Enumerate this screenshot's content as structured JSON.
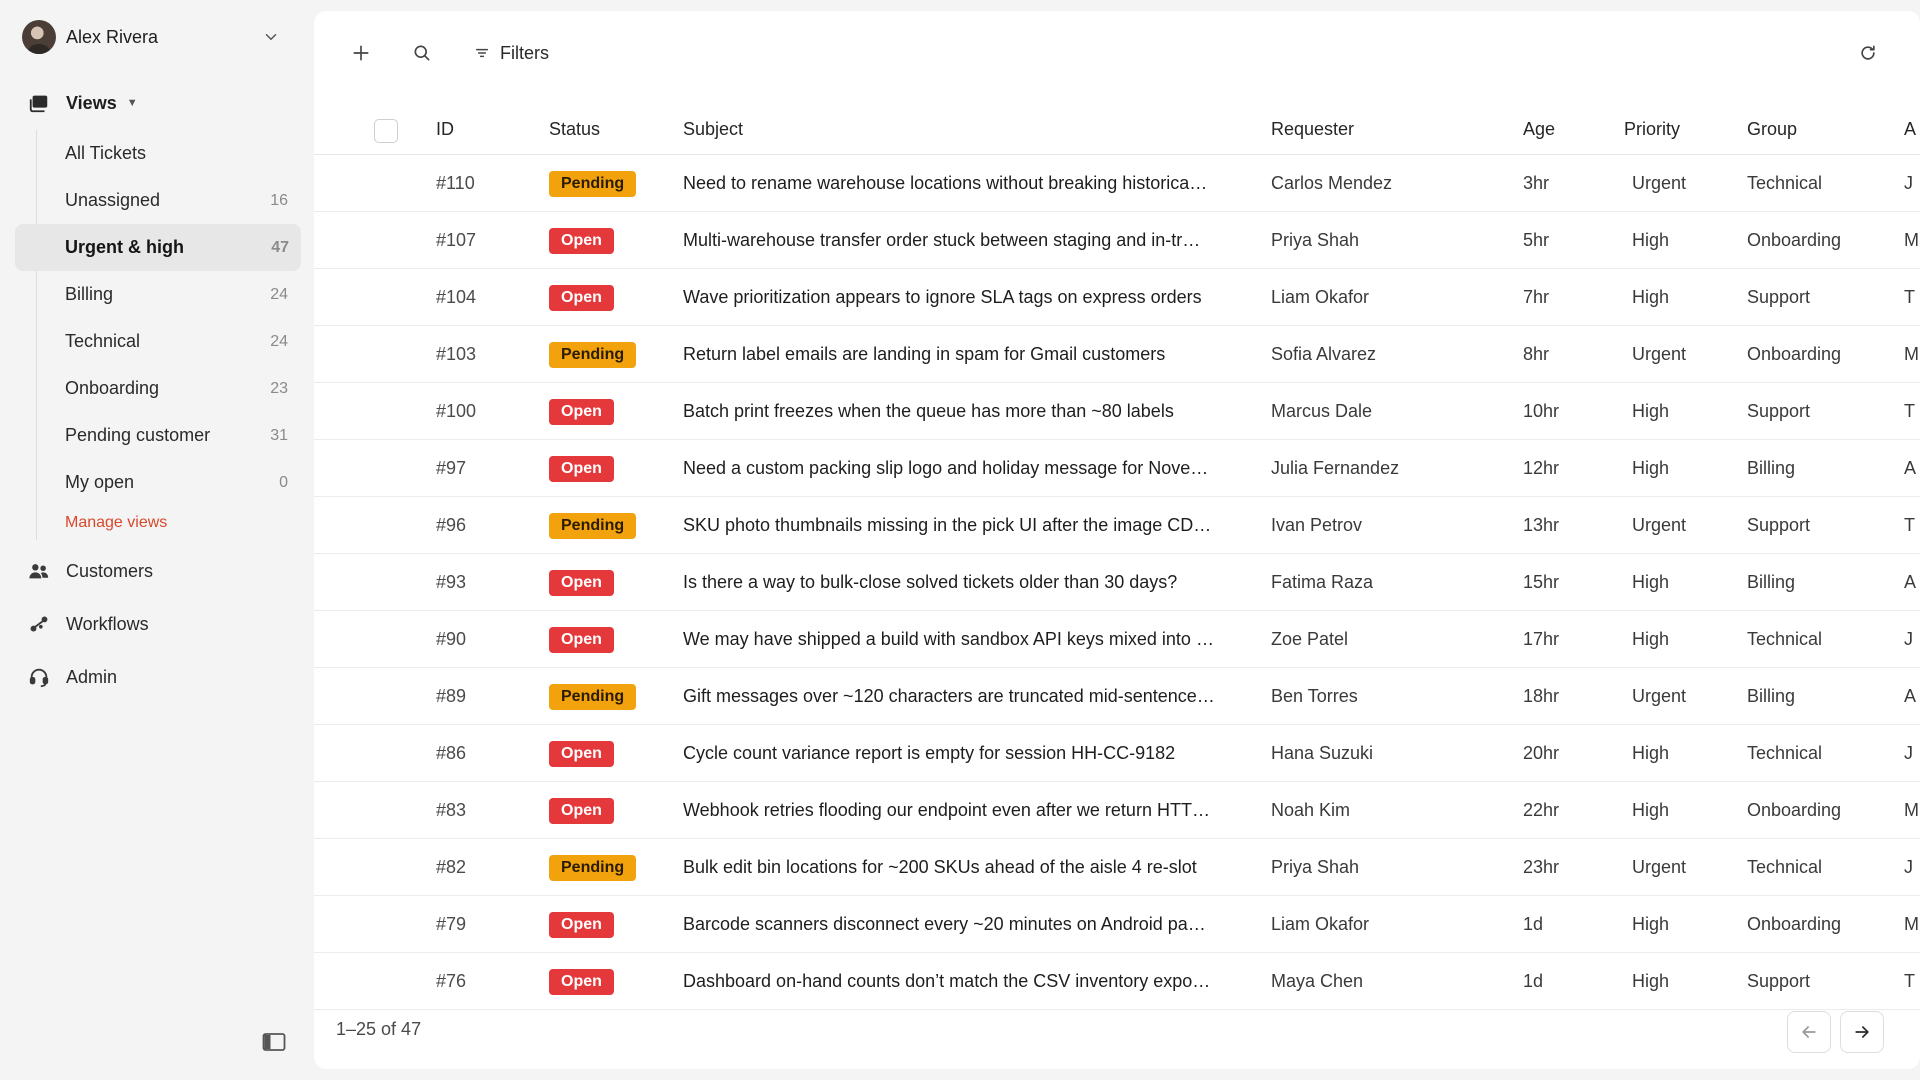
{
  "user": {
    "name": "Alex Rivera"
  },
  "sidebar": {
    "views_label": "Views",
    "views": [
      {
        "label": "All Tickets",
        "count": ""
      },
      {
        "label": "Unassigned",
        "count": "16"
      },
      {
        "label": "Urgent & high",
        "count": "47",
        "active": true
      },
      {
        "label": "Billing",
        "count": "24"
      },
      {
        "label": "Technical",
        "count": "24"
      },
      {
        "label": "Onboarding",
        "count": "23"
      },
      {
        "label": "Pending customer",
        "count": "31"
      },
      {
        "label": "My open",
        "count": "0"
      }
    ],
    "manage_views": "Manage views",
    "nav": [
      {
        "label": "Customers",
        "icon": "users-icon"
      },
      {
        "label": "Workflows",
        "icon": "workflow-icon"
      },
      {
        "label": "Admin",
        "icon": "headset-icon"
      }
    ]
  },
  "toolbar": {
    "filters_label": "Filters"
  },
  "table": {
    "columns": {
      "id": "ID",
      "status": "Status",
      "subject": "Subject",
      "requester": "Requester",
      "age": "Age",
      "priority": "Priority",
      "group": "Group"
    },
    "rows": [
      {
        "id": "#110",
        "status": "Pending",
        "subject": "Need to rename warehouse locations without breaking historica…",
        "requester": "Carlos Mendez",
        "age": "3hr",
        "priority": "Urgent",
        "group": "Technical",
        "extra": "J"
      },
      {
        "id": "#107",
        "status": "Open",
        "subject": "Multi-warehouse transfer order stuck between staging and in-tr…",
        "requester": "Priya Shah",
        "age": "5hr",
        "priority": "High",
        "group": "Onboarding",
        "extra": "M"
      },
      {
        "id": "#104",
        "status": "Open",
        "subject": "Wave prioritization appears to ignore SLA tags on express orders",
        "requester": "Liam Okafor",
        "age": "7hr",
        "priority": "High",
        "group": "Support",
        "extra": "T"
      },
      {
        "id": "#103",
        "status": "Pending",
        "subject": "Return label emails are landing in spam for Gmail customers",
        "requester": "Sofia Alvarez",
        "age": "8hr",
        "priority": "Urgent",
        "group": "Onboarding",
        "extra": "M"
      },
      {
        "id": "#100",
        "status": "Open",
        "subject": "Batch print freezes when the queue has more than ~80 labels",
        "requester": "Marcus Dale",
        "age": "10hr",
        "priority": "High",
        "group": "Support",
        "extra": "T"
      },
      {
        "id": "#97",
        "status": "Open",
        "subject": "Need a custom packing slip logo and holiday message for Nove…",
        "requester": "Julia Fernandez",
        "age": "12hr",
        "priority": "High",
        "group": "Billing",
        "extra": "A"
      },
      {
        "id": "#96",
        "status": "Pending",
        "subject": "SKU photo thumbnails missing in the pick UI after the image CD…",
        "requester": "Ivan Petrov",
        "age": "13hr",
        "priority": "Urgent",
        "group": "Support",
        "extra": "T"
      },
      {
        "id": "#93",
        "status": "Open",
        "subject": "Is there a way to bulk-close solved tickets older than 30 days?",
        "requester": "Fatima Raza",
        "age": "15hr",
        "priority": "High",
        "group": "Billing",
        "extra": "A"
      },
      {
        "id": "#90",
        "status": "Open",
        "subject": "We may have shipped a build with sandbox API keys mixed into …",
        "requester": "Zoe Patel",
        "age": "17hr",
        "priority": "High",
        "group": "Technical",
        "extra": "J"
      },
      {
        "id": "#89",
        "status": "Pending",
        "subject": "Gift messages over ~120 characters are truncated mid-sentence…",
        "requester": "Ben Torres",
        "age": "18hr",
        "priority": "Urgent",
        "group": "Billing",
        "extra": "A"
      },
      {
        "id": "#86",
        "status": "Open",
        "subject": "Cycle count variance report is empty for session HH-CC-9182",
        "requester": "Hana Suzuki",
        "age": "20hr",
        "priority": "High",
        "group": "Technical",
        "extra": "J"
      },
      {
        "id": "#83",
        "status": "Open",
        "subject": "Webhook retries flooding our endpoint even after we return HTT…",
        "requester": "Noah Kim",
        "age": "22hr",
        "priority": "High",
        "group": "Onboarding",
        "extra": "M"
      },
      {
        "id": "#82",
        "status": "Pending",
        "subject": "Bulk edit bin locations for ~200 SKUs ahead of the aisle 4 re-slot",
        "requester": "Priya Shah",
        "age": "23hr",
        "priority": "Urgent",
        "group": "Technical",
        "extra": "J"
      },
      {
        "id": "#79",
        "status": "Open",
        "subject": "Barcode scanners disconnect every ~20 minutes on Android pa…",
        "requester": "Liam Okafor",
        "age": "1d",
        "priority": "High",
        "group": "Onboarding",
        "extra": "M"
      },
      {
        "id": "#76",
        "status": "Open",
        "subject": "Dashboard on-hand counts don’t match the CSV inventory expo…",
        "requester": "Maya Chen",
        "age": "1d",
        "priority": "High",
        "group": "Support",
        "extra": "T"
      }
    ]
  },
  "pagination": {
    "range_text": "1–25 of 47"
  },
  "colors": {
    "pending": "#f2a20c",
    "open": "#e5383b",
    "accent": "#d9482b"
  }
}
